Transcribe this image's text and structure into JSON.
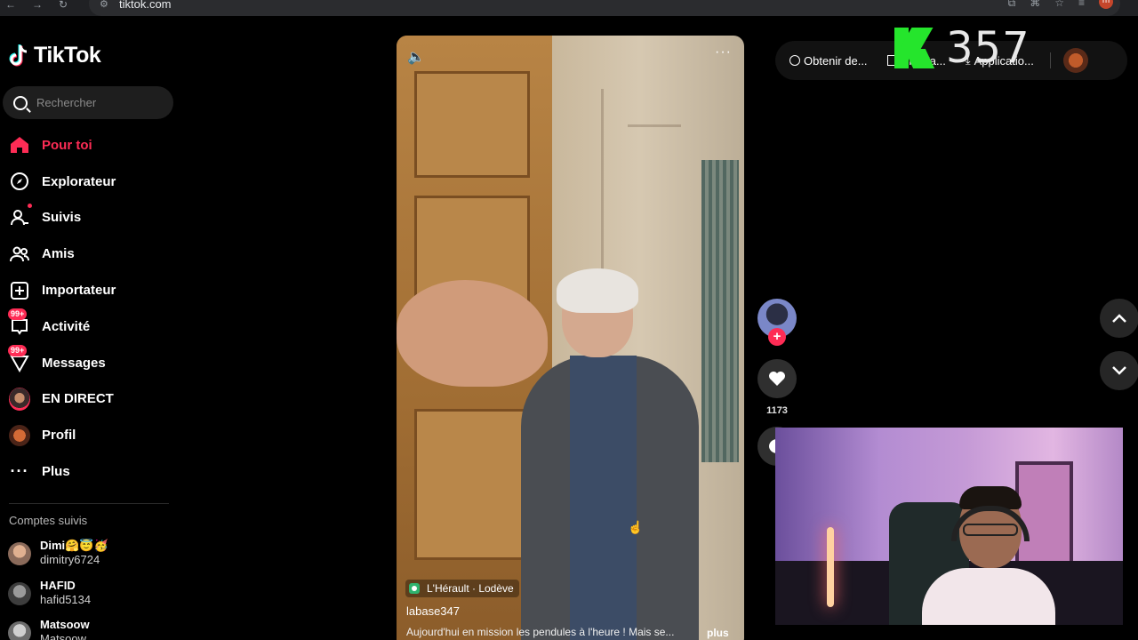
{
  "browser": {
    "url": "tiktok.com",
    "profile_initial": "m"
  },
  "sidebar": {
    "logo_text": "TikTok",
    "search": {
      "placeholder": "Rechercher"
    },
    "items": [
      {
        "label": "Pour toi",
        "icon": "home-icon",
        "active": true
      },
      {
        "label": "Explorateur",
        "icon": "compass-icon"
      },
      {
        "label": "Suivis",
        "icon": "following-icon",
        "dot": true
      },
      {
        "label": "Amis",
        "icon": "friends-icon"
      },
      {
        "label": "Importateur",
        "icon": "upload-icon"
      },
      {
        "label": "Activité",
        "icon": "activity-icon",
        "badge": "99+"
      },
      {
        "label": "Messages",
        "icon": "messages-icon",
        "badge": "99+"
      },
      {
        "label": "EN DIRECT",
        "icon": "live-avatar"
      },
      {
        "label": "Profil",
        "icon": "profile-avatar"
      },
      {
        "label": "Plus",
        "icon": "more-icon"
      }
    ],
    "followed_title": "Comptes suivis",
    "followed": [
      {
        "name": "Dimi🤗😇🥳",
        "handle": "dimitry6724"
      },
      {
        "name": "HAFID",
        "handle": "hafid5134"
      },
      {
        "name": "Matsoow",
        "handle": "Matsoow"
      }
    ]
  },
  "video": {
    "location": "L'Hérault · Lodève",
    "author": "labase347",
    "caption": "Aujourd'hui en mission les pendules à l'heure ! Mais se...",
    "more_label": "plus",
    "like_count": "1173"
  },
  "topbar": {
    "item1": "Obtenir de...",
    "item2": "...nir l'a...",
    "item3": "Applicatio..."
  },
  "overlay": {
    "count": "357"
  },
  "colors": {
    "accent": "#fe2c55",
    "counter_green": "#25e52c"
  }
}
